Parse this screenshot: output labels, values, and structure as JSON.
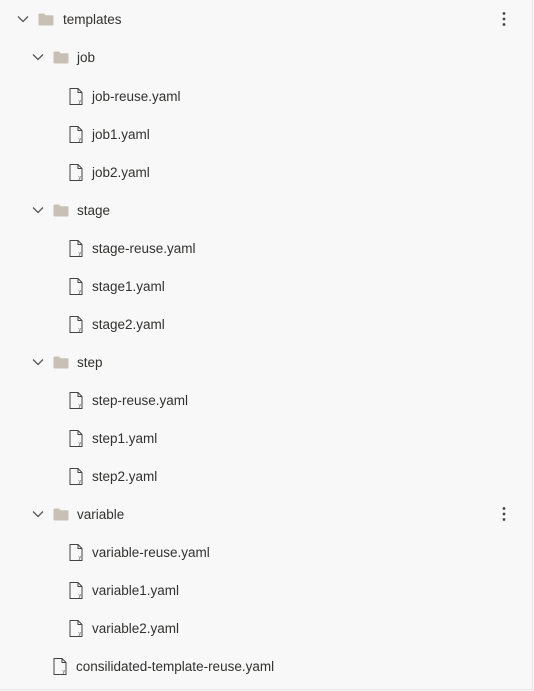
{
  "tree": {
    "root": {
      "label": "templates",
      "expanded": true,
      "folders": [
        {
          "label": "job",
          "expanded": true,
          "files": [
            "job-reuse.yaml",
            "job1.yaml",
            "job2.yaml"
          ]
        },
        {
          "label": "stage",
          "expanded": true,
          "files": [
            "stage-reuse.yaml",
            "stage1.yaml",
            "stage2.yaml"
          ]
        },
        {
          "label": "step",
          "expanded": true,
          "files": [
            "step-reuse.yaml",
            "step1.yaml",
            "step2.yaml"
          ]
        },
        {
          "label": "variable",
          "expanded": true,
          "files": [
            "variable-reuse.yaml",
            "variable1.yaml",
            "variable2.yaml"
          ]
        }
      ],
      "files": [
        "consilidated-template-reuse.yaml"
      ]
    }
  },
  "icons": {
    "folder": "folder-icon",
    "file": "file-icon",
    "chevron": "chevron-down-icon",
    "more": "more-options-icon"
  },
  "colors": {
    "background": "#f8f8f8",
    "folder": "#c8c0b4",
    "text": "#323130"
  }
}
